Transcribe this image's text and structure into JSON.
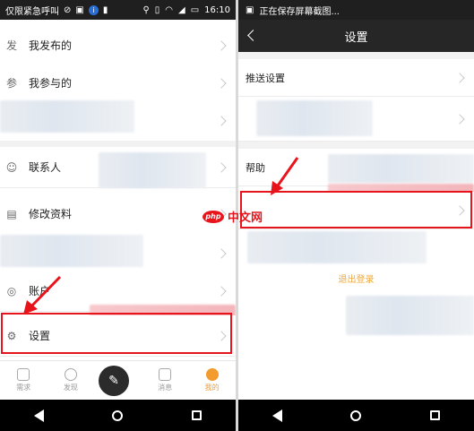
{
  "left": {
    "status": {
      "carrier": "仅限紧急呼叫",
      "time": "16:10"
    },
    "menu": [
      {
        "icon": "发",
        "label": "我发布的"
      },
      {
        "icon": "参",
        "label": "我参与的"
      },
      {
        "icon": "contact-icon",
        "label": "联系人"
      },
      {
        "icon": "profile-card-icon",
        "label": "修改资料"
      },
      {
        "icon": "wallet-icon",
        "label": "账户"
      },
      {
        "icon": "gear-icon",
        "label": "设置"
      }
    ],
    "tabs": [
      {
        "label": "需求",
        "icon": "demand-icon"
      },
      {
        "label": "发现",
        "icon": "discover-icon"
      },
      {
        "label": "消息",
        "icon": "message-icon"
      },
      {
        "label": "我的",
        "icon": "profile-icon"
      }
    ],
    "colors": {
      "accent": "#f39b2f",
      "highlight": "#e8141b"
    }
  },
  "right": {
    "status": {
      "text": "正在保存屏幕截图..."
    },
    "header": {
      "title": "设置"
    },
    "rows": [
      {
        "label": "推送设置"
      },
      {
        "label": "帮助"
      }
    ],
    "logout_label": "退出登录"
  },
  "watermark": {
    "logo": "php",
    "text": "中文网"
  }
}
